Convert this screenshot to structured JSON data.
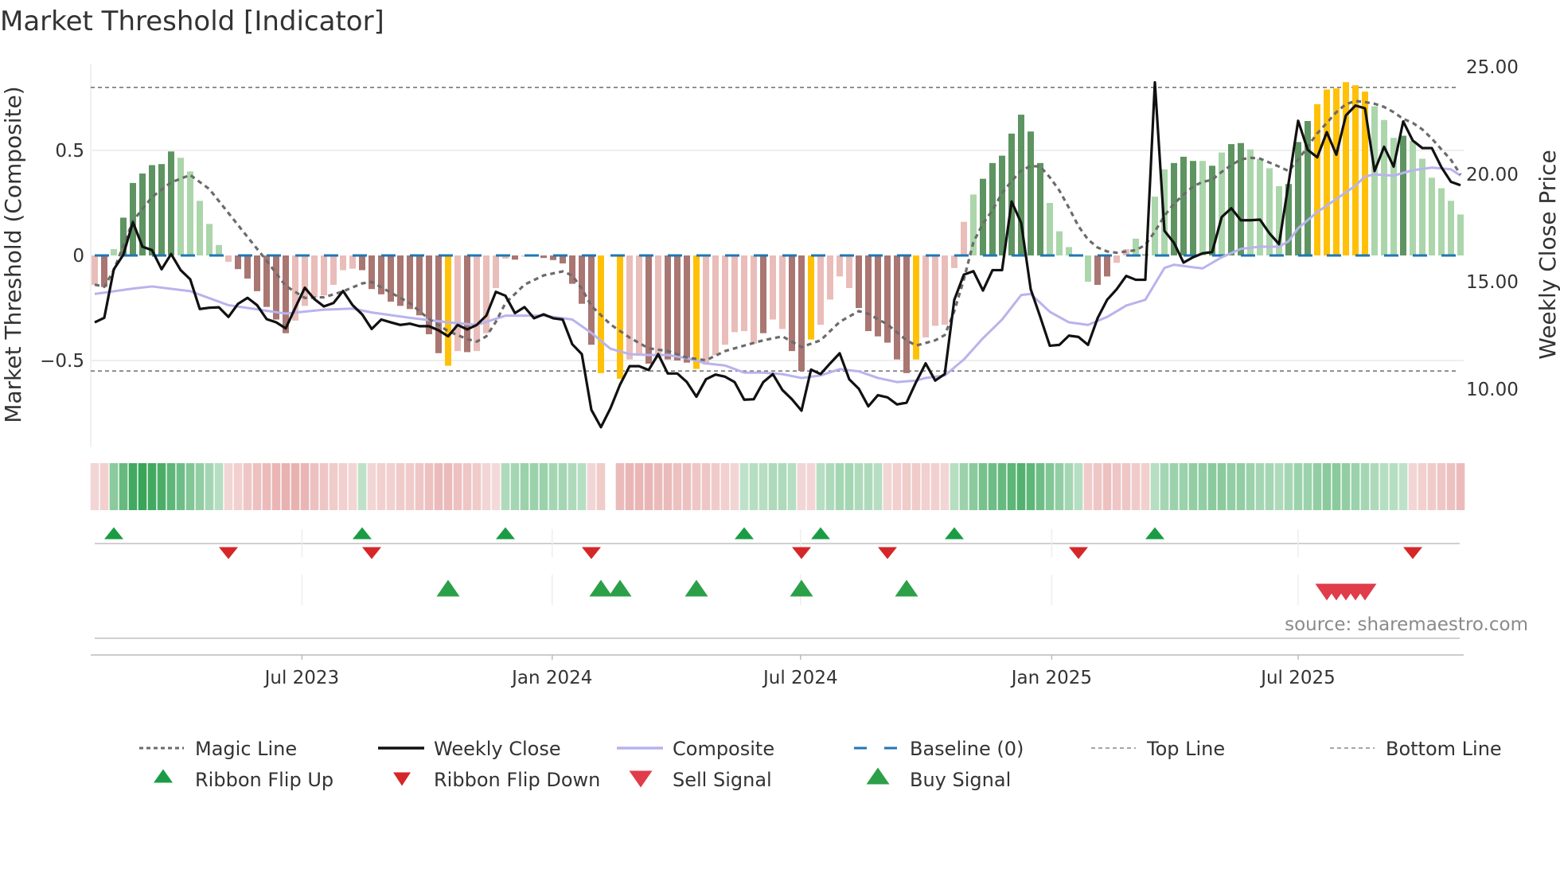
{
  "chart_data": {
    "type": "bar",
    "title": "Market Threshold [Indicator]",
    "ylabel_left": "Market Threshold (Composite)",
    "ylabel_right": "Weekly Close Price",
    "ylim_left": [
      -0.8,
      0.92
    ],
    "ylim_right": [
      7,
      25
    ],
    "yticks_left": [
      {
        "value": 0.5,
        "label": "0.5"
      },
      {
        "value": 0,
        "label": "0"
      },
      {
        "value": -0.5,
        "label": "−0.5"
      }
    ],
    "yticks_right": [
      {
        "value": 25,
        "label": "25.00"
      },
      {
        "value": 20,
        "label": "20.00"
      },
      {
        "value": 15,
        "label": "15.00"
      },
      {
        "value": 10,
        "label": "10.00"
      }
    ],
    "x_unit": "week index",
    "xticks": [
      {
        "at": 21.7,
        "label": "Jul 2023"
      },
      {
        "at": 47.9,
        "label": "Jan 2024"
      },
      {
        "at": 73.9,
        "label": "Jul 2024"
      },
      {
        "at": 100.2,
        "label": "Jan 2025"
      },
      {
        "at": 126,
        "label": "Jul 2025"
      }
    ],
    "top_line": 0.8,
    "bottom_line": -0.55,
    "baseline": 0,
    "composite_bars": [
      -0.14,
      -0.15,
      0.03,
      0.18,
      0.345,
      0.39,
      0.43,
      0.435,
      0.495,
      0.465,
      0.4,
      0.26,
      0.15,
      0.05,
      -0.03,
      -0.065,
      -0.11,
      -0.17,
      -0.245,
      -0.305,
      -0.37,
      -0.31,
      -0.24,
      -0.2,
      -0.19,
      -0.14,
      -0.07,
      -0.063,
      -0.07,
      -0.16,
      -0.185,
      -0.22,
      -0.24,
      -0.255,
      -0.285,
      -0.375,
      -0.465,
      -0.525,
      -0.455,
      -0.46,
      -0.455,
      -0.37,
      -0.155,
      -0.015,
      -0.02,
      -0.005,
      -0.005,
      -0.012,
      -0.022,
      -0.038,
      -0.135,
      -0.23,
      -0.425,
      -0.56,
      null,
      -0.587,
      -0.495,
      -0.477,
      -0.515,
      -0.49,
      -0.495,
      -0.5,
      -0.51,
      -0.54,
      -0.52,
      -0.475,
      -0.425,
      -0.365,
      -0.36,
      -0.42,
      -0.37,
      -0.305,
      -0.35,
      -0.455,
      -0.55,
      -0.4,
      -0.33,
      -0.21,
      -0.1,
      -0.155,
      -0.25,
      -0.36,
      -0.385,
      -0.415,
      -0.495,
      -0.56,
      -0.495,
      -0.39,
      -0.335,
      -0.33,
      -0.06,
      0.16,
      0.29,
      0.365,
      0.44,
      0.475,
      0.58,
      0.67,
      0.59,
      0.44,
      0.25,
      0.115,
      0.04,
      0.005,
      -0.125,
      -0.14,
      -0.1,
      -0.035,
      0.03,
      0.08,
      0.005,
      0.28,
      0.41,
      0.44,
      0.47,
      0.45,
      0.45,
      0.427,
      0.49,
      0.53,
      0.535,
      0.505,
      0.46,
      0.415,
      0.33,
      0.34,
      0.54,
      0.64,
      0.72,
      0.79,
      0.795,
      0.825,
      0.81,
      0.78,
      0.71,
      0.645,
      0.56,
      0.57,
      0.545,
      0.46,
      0.37,
      0.32,
      0.26,
      0.195
    ],
    "bar_states": "pblddddddlllllpbbbbbbpppppppbbbbbbbbbypbppppbppbbbbbbyxyppbpbbbyppppppbppbbyppppbbbbbbypppppldddddddlllllbbppldlldddldlddlllldddyyyyyyllldllllll",
    "bar_state_legend": {
      "d": "rising positive",
      "l": "falling positive",
      "b": "falling negative",
      "p": "rising negative",
      "y": "beyond threshold",
      "x": "no data"
    },
    "weekly_close": [
      13.11,
      13.32,
      15.58,
      16.26,
      17.77,
      16.63,
      16.47,
      15.58,
      16.29,
      15.54,
      15.11,
      13.73,
      13.79,
      13.81,
      13.36,
      13.97,
      14.25,
      13.91,
      13.26,
      13.11,
      12.83,
      13.79,
      14.72,
      14.19,
      13.85,
      14.01,
      14.57,
      13.91,
      13.48,
      12.8,
      13.24,
      13.11,
      12.99,
      13.05,
      12.93,
      12.93,
      12.74,
      12.46,
      12.99,
      12.78,
      12.99,
      13.42,
      14.53,
      14.35,
      13.54,
      13.82,
      13.3,
      13.48,
      13.3,
      13.24,
      12.09,
      11.63,
      9.04,
      8.23,
      9.11,
      10.21,
      11.07,
      11.07,
      10.89,
      11.63,
      10.73,
      10.73,
      10.33,
      9.65,
      10.46,
      10.68,
      10.58,
      10.33,
      9.51,
      9.53,
      10.33,
      10.7,
      9.96,
      9.53,
      9.0,
      10.91,
      10.7,
      11.2,
      11.67,
      10.46,
      10.02,
      9.2,
      9.72,
      9.62,
      9.29,
      9.37,
      10.33,
      11.2,
      10.4,
      10.7,
      14.16,
      15.33,
      15.49,
      14.59,
      15.54,
      15.54,
      18.73,
      17.74,
      14.65,
      13.36,
      12.02,
      12.06,
      12.49,
      12.43,
      12.06,
      13.3,
      14.16,
      14.65,
      15.27,
      15.09,
      15.09,
      24.28,
      17.37,
      16.81,
      15.89,
      16.14,
      16.32,
      16.38,
      18.01,
      18.42,
      17.86,
      17.86,
      17.89,
      17.25,
      16.75,
      19.59,
      22.49,
      21.14,
      20.79,
      21.96,
      20.91,
      22.74,
      23.2,
      23.07,
      20.15,
      21.28,
      20.36,
      22.46,
      21.57,
      21.22,
      21.22,
      20.33,
      19.65,
      19.49
    ],
    "composite_line": [
      [
        0,
        14.43
      ],
      [
        4,
        14.68
      ],
      [
        6,
        14.78
      ],
      [
        10,
        14.56
      ],
      [
        14,
        13.91
      ],
      [
        20,
        13.52
      ],
      [
        24,
        13.7
      ],
      [
        27,
        13.75
      ],
      [
        29,
        13.57
      ],
      [
        33,
        13.32
      ],
      [
        37,
        13.11
      ],
      [
        40,
        12.99
      ],
      [
        43,
        13.42
      ],
      [
        47,
        13.42
      ],
      [
        50,
        13.24
      ],
      [
        52,
        12.62
      ],
      [
        54,
        11.88
      ],
      [
        56,
        11.63
      ],
      [
        58,
        11.59
      ],
      [
        60,
        11.59
      ],
      [
        62,
        11.44
      ],
      [
        64,
        11.2
      ],
      [
        66,
        11.1
      ],
      [
        68,
        10.77
      ],
      [
        70,
        10.77
      ],
      [
        72,
        10.7
      ],
      [
        74,
        10.52
      ],
      [
        76,
        10.64
      ],
      [
        78,
        10.93
      ],
      [
        80,
        10.83
      ],
      [
        82,
        10.52
      ],
      [
        84,
        10.33
      ],
      [
        86,
        10.4
      ],
      [
        87,
        10.52
      ],
      [
        89,
        10.64
      ],
      [
        91,
        11.38
      ],
      [
        93,
        12.37
      ],
      [
        95,
        13.24
      ],
      [
        97,
        14.38
      ],
      [
        98,
        14.43
      ],
      [
        100,
        13.6
      ],
      [
        102,
        13.11
      ],
      [
        104,
        12.99
      ],
      [
        106,
        13.36
      ],
      [
        108,
        13.89
      ],
      [
        110,
        14.16
      ],
      [
        112,
        15.64
      ],
      [
        113,
        15.79
      ],
      [
        115,
        15.67
      ],
      [
        116,
        15.62
      ],
      [
        118,
        16.14
      ],
      [
        120,
        16.53
      ],
      [
        122,
        16.63
      ],
      [
        124,
        16.63
      ],
      [
        125,
        16.88
      ],
      [
        126,
        17.49
      ],
      [
        128,
        18.24
      ],
      [
        130,
        18.85
      ],
      [
        132,
        19.47
      ],
      [
        133,
        19.9
      ],
      [
        134,
        19.99
      ],
      [
        136,
        19.94
      ],
      [
        138,
        20.19
      ],
      [
        140,
        20.31
      ],
      [
        142,
        20.23
      ],
      [
        143,
        19.94
      ]
    ],
    "magic_line": [
      [
        0,
        -0.139
      ],
      [
        1,
        -0.149
      ],
      [
        2,
        -0.07
      ],
      [
        4,
        0.164
      ],
      [
        6,
        0.278
      ],
      [
        8,
        0.348
      ],
      [
        10,
        0.383
      ],
      [
        12,
        0.316
      ],
      [
        14,
        0.202
      ],
      [
        16,
        0.088
      ],
      [
        18,
        -0.025
      ],
      [
        20,
        -0.145
      ],
      [
        22,
        -0.202
      ],
      [
        24,
        -0.199
      ],
      [
        26,
        -0.171
      ],
      [
        28,
        -0.133
      ],
      [
        29,
        -0.126
      ],
      [
        31,
        -0.177
      ],
      [
        33,
        -0.227
      ],
      [
        35,
        -0.303
      ],
      [
        37,
        -0.36
      ],
      [
        39,
        -0.398
      ],
      [
        40,
        -0.41
      ],
      [
        41,
        -0.385
      ],
      [
        42,
        -0.316
      ],
      [
        43,
        -0.227
      ],
      [
        45,
        -0.139
      ],
      [
        47,
        -0.095
      ],
      [
        49,
        -0.076
      ],
      [
        50,
        -0.095
      ],
      [
        51,
        -0.158
      ],
      [
        52,
        -0.24
      ],
      [
        54,
        -0.328
      ],
      [
        56,
        -0.391
      ],
      [
        58,
        -0.442
      ],
      [
        60,
        -0.455
      ],
      [
        62,
        -0.486
      ],
      [
        64,
        -0.499
      ],
      [
        66,
        -0.455
      ],
      [
        68,
        -0.429
      ],
      [
        70,
        -0.404
      ],
      [
        72,
        -0.385
      ],
      [
        74,
        -0.436
      ],
      [
        76,
        -0.404
      ],
      [
        78,
        -0.316
      ],
      [
        80,
        -0.265
      ],
      [
        81,
        -0.278
      ],
      [
        83,
        -0.328
      ],
      [
        85,
        -0.404
      ],
      [
        86,
        -0.429
      ],
      [
        88,
        -0.404
      ],
      [
        89,
        -0.379
      ],
      [
        90,
        -0.265
      ],
      [
        91,
        -0.114
      ],
      [
        92,
        0.063
      ],
      [
        93,
        0.152
      ],
      [
        94,
        0.215
      ],
      [
        95,
        0.297
      ],
      [
        96,
        0.354
      ],
      [
        97,
        0.404
      ],
      [
        98,
        0.426
      ],
      [
        99,
        0.423
      ],
      [
        100,
        0.372
      ],
      [
        101,
        0.309
      ],
      [
        102,
        0.227
      ],
      [
        103,
        0.139
      ],
      [
        104,
        0.076
      ],
      [
        105,
        0.038
      ],
      [
        106,
        0.019
      ],
      [
        107,
        0.013
      ],
      [
        109,
        0.025
      ],
      [
        110,
        0.05
      ],
      [
        111,
        0.114
      ],
      [
        112,
        0.189
      ],
      [
        113,
        0.246
      ],
      [
        114,
        0.29
      ],
      [
        115,
        0.328
      ],
      [
        116,
        0.35
      ],
      [
        117,
        0.36
      ],
      [
        118,
        0.398
      ],
      [
        119,
        0.43
      ],
      [
        120,
        0.457
      ],
      [
        121,
        0.465
      ],
      [
        122,
        0.461
      ],
      [
        123,
        0.442
      ],
      [
        124,
        0.423
      ],
      [
        125,
        0.402
      ],
      [
        126,
        0.455
      ],
      [
        127,
        0.518
      ],
      [
        128,
        0.581
      ],
      [
        129,
        0.631
      ],
      [
        130,
        0.682
      ],
      [
        131,
        0.72
      ],
      [
        132,
        0.735
      ],
      [
        133,
        0.73
      ],
      [
        134,
        0.722
      ],
      [
        135,
        0.707
      ],
      [
        136,
        0.682
      ],
      [
        137,
        0.65
      ],
      [
        138,
        0.631
      ],
      [
        139,
        0.6
      ],
      [
        140,
        0.556
      ],
      [
        141,
        0.505
      ],
      [
        142,
        0.455
      ],
      [
        143,
        0.385
      ]
    ],
    "ribbon": [
      -0.15,
      -0.2,
      0.45,
      0.65,
      0.85,
      0.9,
      0.85,
      0.8,
      0.7,
      0.6,
      0.5,
      0.4,
      0.3,
      0.2,
      -0.15,
      -0.2,
      -0.3,
      -0.35,
      -0.4,
      -0.45,
      -0.5,
      -0.5,
      -0.45,
      -0.35,
      -0.3,
      -0.25,
      -0.2,
      -0.15,
      0.15,
      -0.15,
      -0.2,
      -0.2,
      -0.25,
      -0.25,
      -0.3,
      -0.35,
      -0.4,
      -0.4,
      -0.35,
      -0.3,
      -0.25,
      -0.15,
      -0.1,
      0.25,
      0.3,
      0.35,
      0.35,
      0.35,
      0.3,
      0.3,
      0.25,
      0.2,
      -0.15,
      -0.25,
      null,
      -0.4,
      -0.45,
      -0.45,
      -0.45,
      -0.4,
      -0.4,
      -0.35,
      -0.35,
      -0.3,
      -0.3,
      -0.25,
      -0.2,
      -0.15,
      0.15,
      0.2,
      0.2,
      0.25,
      0.25,
      0.2,
      -0.15,
      -0.15,
      0.2,
      0.25,
      0.3,
      0.3,
      0.25,
      0.25,
      0.2,
      -0.15,
      -0.2,
      -0.25,
      -0.25,
      -0.2,
      -0.2,
      -0.15,
      0.2,
      0.35,
      0.45,
      0.55,
      0.6,
      0.65,
      0.7,
      0.75,
      0.7,
      0.6,
      0.5,
      0.4,
      0.3,
      0.2,
      -0.25,
      -0.3,
      -0.35,
      -0.3,
      -0.3,
      -0.25,
      -0.2,
      0.2,
      0.3,
      0.35,
      0.35,
      0.4,
      0.4,
      0.45,
      0.45,
      0.4,
      0.4,
      0.35,
      0.3,
      0.3,
      0.25,
      0.3,
      0.35,
      0.35,
      0.4,
      0.45,
      0.45,
      0.4,
      0.35,
      0.3,
      0.25,
      0.2,
      0.2,
      0.15,
      -0.15,
      -0.2,
      -0.25,
      -0.3,
      -0.35,
      -0.4
    ],
    "ribbon_flip_up": [
      2,
      28,
      43,
      68,
      76,
      90,
      111
    ],
    "ribbon_flip_down": [
      14,
      29,
      52,
      74,
      83,
      103,
      138
    ],
    "buy_signal": [
      37,
      53,
      55,
      63,
      74,
      85
    ],
    "sell_signal": [
      129,
      130,
      131,
      132,
      133
    ],
    "colors": {
      "bar_dark_green": "#5e9461",
      "bar_light_green": "#abd6ab",
      "bar_brown": "#a97672",
      "bar_pink": "#e9bdb9",
      "bar_yellow": "#ffc107",
      "weekly_close": "#111111",
      "composite": "#b9b3ec",
      "magic": "#6b6b6b",
      "baseline": "#1f77b4",
      "threshold": "#777777",
      "flip_up": "#1a9c45",
      "flip_down": "#d62728",
      "buy": "#2ca048",
      "sell": "#e03c4a"
    },
    "legend": [
      {
        "label": "Magic Line",
        "kind": "dotted",
        "color": "#6b6b6b"
      },
      {
        "label": "Weekly Close",
        "kind": "line",
        "color": "#111111"
      },
      {
        "label": "Composite",
        "kind": "line",
        "color": "#b9b3ec"
      },
      {
        "label": "Baseline (0)",
        "kind": "dashed",
        "color": "#1f77b4"
      },
      {
        "label": "Top Line",
        "kind": "thin-dash",
        "color": "#888888"
      },
      {
        "label": "Bottom Line",
        "kind": "thin-dash",
        "color": "#888888"
      },
      {
        "label": "Ribbon Flip Up",
        "kind": "tri-up-small",
        "color": "#1a9c45"
      },
      {
        "label": "Ribbon Flip Down",
        "kind": "tri-down-small",
        "color": "#d62728"
      },
      {
        "label": "Sell Signal",
        "kind": "tri-down",
        "color": "#e03c4a"
      },
      {
        "label": "Buy Signal",
        "kind": "tri-up",
        "color": "#2ca048"
      }
    ],
    "legend_placement": "bottom",
    "source": "source: sharemaestro.com"
  }
}
